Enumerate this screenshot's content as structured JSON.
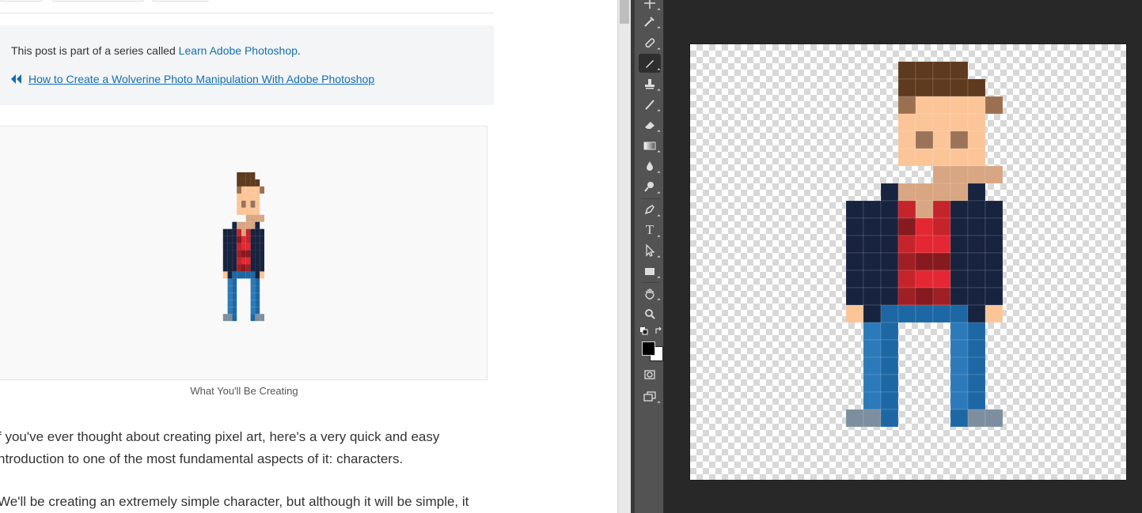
{
  "article": {
    "series_prefix": "This post is part of a series called ",
    "series_link": "Learn Adobe Photoshop",
    "series_suffix": ".",
    "prev_link": "How to Create a Wolverine Photo Manipulation With Adobe Photoshop",
    "caption": "What You'll Be Creating",
    "paragraph1_line1": "f you've ever thought about creating pixel art, here's a very quick and easy",
    "paragraph1_line2": "ntroduction to one of the most fundamental aspects of it: characters.",
    "paragraph2_line1": "We'll be creating an extremely simple character, but although it will be simple, it",
    "link_color": "#136fb0"
  },
  "photoshop": {
    "tools": [
      "move-tool",
      "eyedropper-tool",
      "spot-healing-tool",
      "pencil-tool",
      "clone-stamp-tool",
      "history-brush-tool",
      "eraser-tool",
      "gradient-tool",
      "blur-tool",
      "dodge-tool",
      "pen-tool",
      "type-tool",
      "path-selection-tool",
      "rectangle-tool",
      "hand-tool",
      "zoom-tool",
      "quick-mask-tool",
      "screen-mode-tool"
    ],
    "active_tool": "pencil-tool",
    "type_tool_glyph": "T",
    "foreground_color": "#000000",
    "background_color": "#ffffff"
  },
  "pixel_character": {
    "palette": {
      "h": "#5e3a1e",
      "e": "#9b7051",
      "s": "#fbc598",
      "y": "#9a7359",
      "n": "#d8a682",
      "j": "#17233f",
      "r": "#c5242b",
      "R": "#e32833",
      "d": "#861a1f",
      "k": "#a01f25",
      "b": "#2c7ab9",
      "c": "#1d68a4",
      "g": "#7d8f9f"
    },
    "rows": [
      "....hhhh.",
      "....hhhhh",
      "....esssse",
      "....sssss",
      "....sysys",
      "....sssss",
      "......nnnn",
      "...jnnnnj",
      ".jjjrnrjjj",
      ".jjjdRrjjj",
      ".jjjrRRjjj",
      ".jjjkddjjj",
      ".jjjrRRjjj",
      ".jjjkdkjjj",
      ".sjcccccjs",
      "..bc...bc",
      "..bc...bc",
      "..bc...bc",
      "..bc...bc",
      "..bc...bc",
      ".ggc...cgg"
    ]
  }
}
